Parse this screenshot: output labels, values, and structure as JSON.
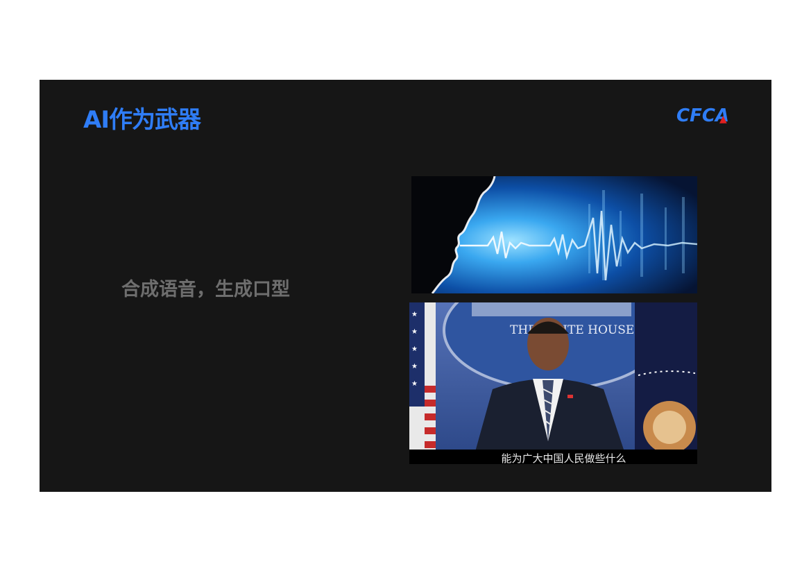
{
  "slide": {
    "title": "AI作为武器",
    "logo_text": "CFCA",
    "subtitle": "合成语音，生成口型"
  },
  "video": {
    "caption": "能为广大中国人民做些什么",
    "seal_text": "THE WHITE HOUSE"
  },
  "colors": {
    "accent": "#2f7df6",
    "slide_bg": "#161616",
    "subtitle": "#6e6e6e"
  }
}
